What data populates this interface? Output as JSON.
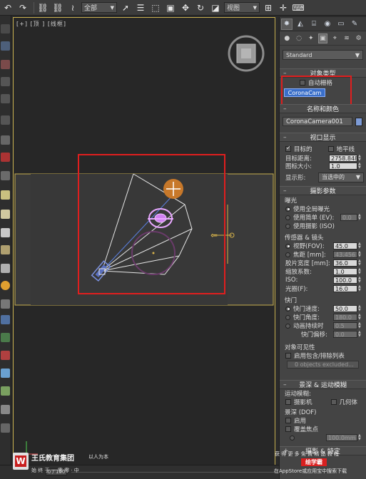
{
  "toolbar": {
    "selection_filter": "全部",
    "ref_coord": "视图"
  },
  "viewport": {
    "label": "[+] [顶 ] [线框]"
  },
  "command_panel": {
    "category_dropdown": "Standard",
    "object_type": {
      "title": "对象类型",
      "auto_grid_label": "自动栅格",
      "auto_grid_checked": false,
      "button": "CoronaCam"
    },
    "name_color": {
      "title": "名称和颜色",
      "name": "CoronaCamera001",
      "color": "#7d9bd6"
    },
    "viewport_display": {
      "title": "视口显示",
      "targeted_label": "目标的",
      "targeted_checked": true,
      "horizon_label": "地平线",
      "horizon_checked": false,
      "target_dist_label": "目标距离:",
      "target_dist_value": "2758.848",
      "icon_size_label": "图标大小:",
      "icon_size_value": "1.0",
      "display_label": "显示形:",
      "display_value": "当选中的"
    },
    "camera_params": {
      "title": "摄影参数",
      "exposure_label": "曝光",
      "exposure_options": [
        "使用全局曝光",
        "使用简单 (EV):",
        "使用摄影 (ISO)"
      ],
      "exposure_selected": 0,
      "ev_value": "0.0",
      "sensor_label": "传感器 & 镜头",
      "fov_label": "视野(FOV):",
      "fov_value": "45.0",
      "focal_label": "焦距 [mm]:",
      "focal_value": "43.456",
      "lens_selected": 0,
      "film_width_label": "胶片宽度 [mm]:",
      "film_width_value": "36.0",
      "zoom_label": "缩放系数:",
      "zoom_value": "1.0",
      "iso_label": "ISO:",
      "iso_value": "100.0",
      "fstop_label": "光圈(F):",
      "fstop_value": "16.0",
      "shutter_label": "快门",
      "shutter_speed_label": "快门速度:",
      "shutter_speed_value": "50.0",
      "shutter_angle_label": "快门角度:",
      "shutter_angle_value": "180.0",
      "motion_dur_label": "动画持续时",
      "motion_dur_value": "0.5",
      "shutter_offset_label": "快门偏移:",
      "shutter_offset_value": "0.0",
      "shutter_selected": 0
    },
    "visibility": {
      "title": "对象可见性",
      "use_include_label": "启用包含/排除列表",
      "excluded_text": "0 objects excluded..."
    },
    "dof_motion": {
      "title": "景深 & 运动模糊",
      "motion_blur_label": "运动模糊:",
      "camera_label": "摄影机",
      "geometry_label": "几何体",
      "dof_label": "景深 (DOF)",
      "enable_label": "启用",
      "override_focus_label": "覆盖焦点",
      "focus_value": "100.0mm"
    },
    "bottom_cut": "摄影 & 特定"
  },
  "watermark": {
    "brand": "王氏教育集团",
    "slogan": "以人为本",
    "sub": "始 终 于 一 零 零 · 中",
    "right_top": "获 得 更 多 免 费 精 品 教 程",
    "app_name": "绘学霸",
    "right_bottom": "在AppStore或应用宝中搜索下载",
    "frame_text": "0 / 100"
  },
  "colors": {
    "highlight": "#e01e1e",
    "viewport_border": "#c8b050",
    "selected_button": "#3a6fc9"
  }
}
